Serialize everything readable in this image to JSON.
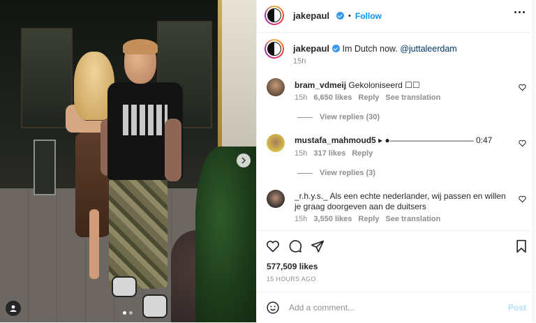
{
  "post": {
    "author": "jakepaul",
    "follow_label": "Follow",
    "bullet": "•",
    "caption_text": "Im Dutch now.",
    "caption_mention": "@juttaleerdam",
    "caption_time": "15h",
    "likes": "577,509 likes",
    "posted_ago": "15 HOURS AGO"
  },
  "comments": [
    {
      "user": "bram_vdmeij",
      "text": "Gekoloniseerd ☐☐",
      "time": "15h",
      "likes": "6,650 likes",
      "reply": "Reply",
      "translate": "See translation",
      "view_replies": "View replies (30)"
    },
    {
      "user": "mustafa_mahmoud5",
      "text": "▸ ●—————————— 0:47",
      "time": "15h",
      "likes": "317 likes",
      "reply": "Reply",
      "view_replies": "View replies (3)"
    },
    {
      "user": "_r.h.y.s._",
      "text": "Als een echte nederlander, wij passen en willen je graag doorgeven aan de duitsers",
      "time": "15h",
      "likes": "3,550 likes",
      "reply": "Reply",
      "translate": "See translation"
    }
  ],
  "composer": {
    "placeholder": "Add a comment...",
    "post_label": "Post"
  },
  "icons": {
    "like": "heart-icon",
    "comment": "comment-icon",
    "share": "paper-plane-icon",
    "save": "bookmark-icon",
    "emoji": "smiley-icon",
    "more": "more-horizontal-icon",
    "next": "chevron-right-icon",
    "tag": "user-tag-icon"
  },
  "colors": {
    "link_blue": "#0095f6",
    "mention": "#00376b",
    "muted": "#8e8e8e",
    "post_disabled": "#b2dffc"
  }
}
